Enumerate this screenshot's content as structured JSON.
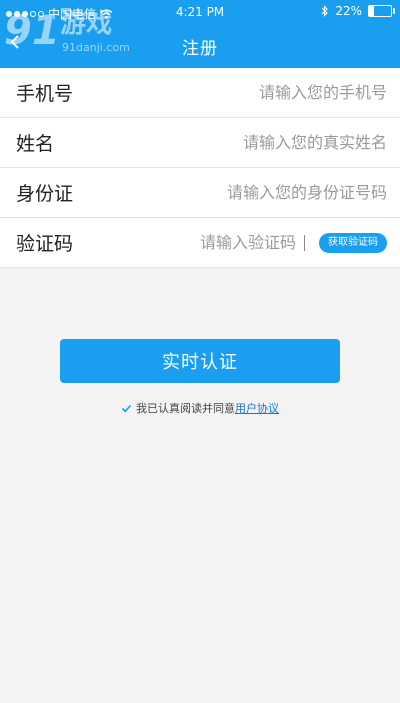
{
  "status_bar": {
    "carrier": "中国电信",
    "time": "4:21 PM",
    "battery": "22%",
    "battery_level": 0.22,
    "signal_bars_filled": 3,
    "signal_bars_total": 5
  },
  "watermark": {
    "logo_text": "91游戏",
    "domain": "91danji.com"
  },
  "header": {
    "title": "注册",
    "background_color": "#1a9ff0"
  },
  "form": {
    "rows": [
      {
        "label": "手机号",
        "placeholder": "请输入您的手机号",
        "value": ""
      },
      {
        "label": "姓名",
        "placeholder": "请输入您的真实姓名",
        "value": ""
      },
      {
        "label": "身份证",
        "placeholder": "请输入您的身份证号码",
        "value": ""
      },
      {
        "label": "验证码",
        "placeholder": "请输入验证码",
        "value": ""
      }
    ],
    "get_code_button": "获取验证码"
  },
  "submit_button": "实时认证",
  "agreement": {
    "checked": true,
    "text": "我已认真阅读并同意",
    "link": "用户协议"
  },
  "icons": [
    "signal-icon",
    "wifi-icon",
    "back-arrow-icon",
    "bluetooth-icon",
    "battery-icon",
    "checkmark-icon"
  ],
  "accent_color": "#1a9ff0"
}
